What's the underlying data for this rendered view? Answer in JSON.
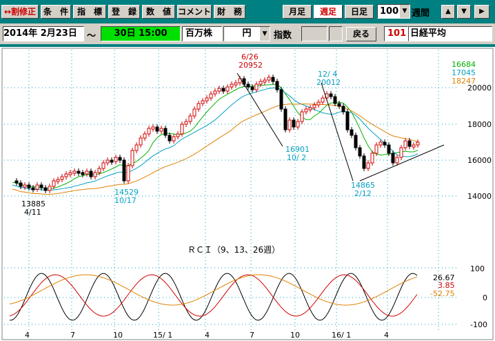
{
  "toolbar": {
    "buttons": [
      "↔割修正",
      "条　件",
      "指　標",
      "登　録",
      "数　値",
      "コメント",
      "財　務"
    ],
    "periods": [
      "月足",
      "週足",
      "日足"
    ],
    "active_period": "週足",
    "count_value": "100",
    "count_unit": "週間",
    "nav_up": "▲",
    "nav_down": "▼",
    "nav_right": "▶"
  },
  "info_bar": {
    "date": "2014年 2月23日",
    "tilde": "～",
    "time": "30日 15:00",
    "unit": "百万株",
    "currency": "円",
    "index_label": "指数",
    "back_label": "戻る",
    "code": "101",
    "name": "日経平均"
  },
  "legend": {
    "ma1": "16684",
    "ma2": "17045",
    "ma3": "18247"
  },
  "colors": {
    "ma1": "#00b000",
    "ma2": "#00a0c0",
    "ma3": "#e08000",
    "up_candle": "#d00000",
    "down_candle": "#000000",
    "rci_short": "#000000",
    "rci_mid": "#d00000",
    "rci_long": "#e08000"
  },
  "price_axis": [
    "20000",
    "18000",
    "16000",
    "14000"
  ],
  "annotations": [
    {
      "label": "6/26\n20952",
      "color": "#d00000"
    },
    {
      "label": "12/ 4\n20012",
      "color": "#00a0c0"
    },
    {
      "label": "16901\n10/ 2",
      "color": "#00a0c0"
    },
    {
      "label": "14865\n2/12",
      "color": "#00a0c0"
    },
    {
      "label": "14529\n10/17",
      "color": "#00a0c0"
    },
    {
      "label": "13885\n4/11",
      "color": "#000000"
    }
  ],
  "rci": {
    "title": "ＲＣＩ（9、13、26週）",
    "axis": [
      "100",
      "0",
      "-100"
    ],
    "values": [
      "26.67",
      "3.85",
      "-52.75"
    ]
  },
  "x_axis": [
    "4",
    "7",
    "10",
    "15/ 1",
    "4",
    "7",
    "10",
    "16/ 1",
    "4"
  ]
}
